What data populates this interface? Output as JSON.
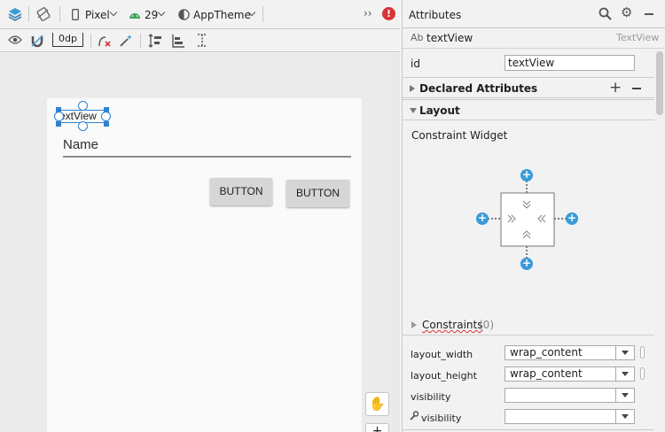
{
  "toolbar": {
    "device": "Pixel",
    "api_level": "29",
    "theme": "AppTheme",
    "overflow": "››",
    "default_margin": "0dp"
  },
  "canvas": {
    "textview_text": "TextView",
    "edittext_text": "Name",
    "button1_label": "BUTTON",
    "button2_label": "BUTTON",
    "pan_icon": "hand-icon",
    "zoom_icon": "plus-icon"
  },
  "attributes": {
    "title": "Attributes",
    "component_icon_text": "Ab",
    "component_name": "textView",
    "component_type": "TextView",
    "id_label": "id",
    "id_value": "textView",
    "declared_section": "Declared Attributes",
    "layout_section": "Layout",
    "constraint_widget_label": "Constraint Widget",
    "constraints_label": "Constraints",
    "constraints_count": "(0)",
    "props": [
      {
        "label": "layout_width",
        "value": "wrap_content"
      },
      {
        "label": "layout_height",
        "value": "wrap_content"
      },
      {
        "label": "visibility",
        "value": ""
      },
      {
        "label": "visibility",
        "value": ""
      }
    ]
  },
  "colors": {
    "accent": "#2f82d2",
    "plus_blue": "#3a9bd8",
    "error_red": "#d8343a"
  }
}
